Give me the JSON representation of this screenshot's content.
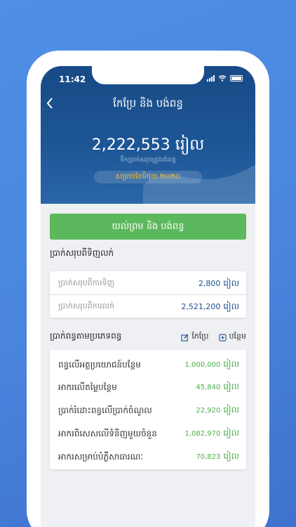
{
  "status": {
    "time": "11:42"
  },
  "header": {
    "title": "កែប្រែ និង បង់ពន្ធ",
    "amount": "2,222,553 រៀល",
    "amount_sub": "ទឹកប្រាក់សរុបត្រូវបង់ពន្ធ",
    "period": "សម្រាប់ខែមិថុនា ២០២០"
  },
  "confirm_label": "យល់ព្រម និង បង់ពន្ធ",
  "section_income": {
    "title": "ប្រាក់សរុបពីទិញលក់",
    "rows": [
      {
        "label": "ប្រាក់សរុបពីការទិញ",
        "value": "2,800",
        "unit": "រៀល"
      },
      {
        "label": "ប្រាក់សរុបពីការលក់",
        "value": "2,521,200",
        "unit": "រៀល"
      }
    ]
  },
  "section_tax": {
    "title": "ប្រាក់ពន្ធតាមប្រភេទពន្ធ",
    "edit_label": "កែប្រែ",
    "add_label": "បន្ថែម",
    "rows": [
      {
        "label": "ពន្ធលើអត្ថប្រយោជន៍បន្ថែម",
        "value": "1,000,000",
        "unit": "រៀល"
      },
      {
        "label": "អាករលើតម្លៃបន្ថែម",
        "value": "45,840",
        "unit": "រៀល"
      },
      {
        "label": "ប្រាក់រំដោះពន្ធលើប្រាក់ចំណូល",
        "value": "22,920",
        "unit": "រៀល"
      },
      {
        "label": "អាករពិសេសលើទំនិញមួយចំនួន",
        "value": "1,082,970",
        "unit": "រៀល"
      },
      {
        "label": "អាករសម្រាប់បំភ្លឺសាធារណៈ",
        "value": "70,823",
        "unit": "រៀល"
      }
    ]
  },
  "colors": {
    "header": "#1e5796",
    "accent": "#5cb85c",
    "value_blue": "#1c4f8f"
  }
}
